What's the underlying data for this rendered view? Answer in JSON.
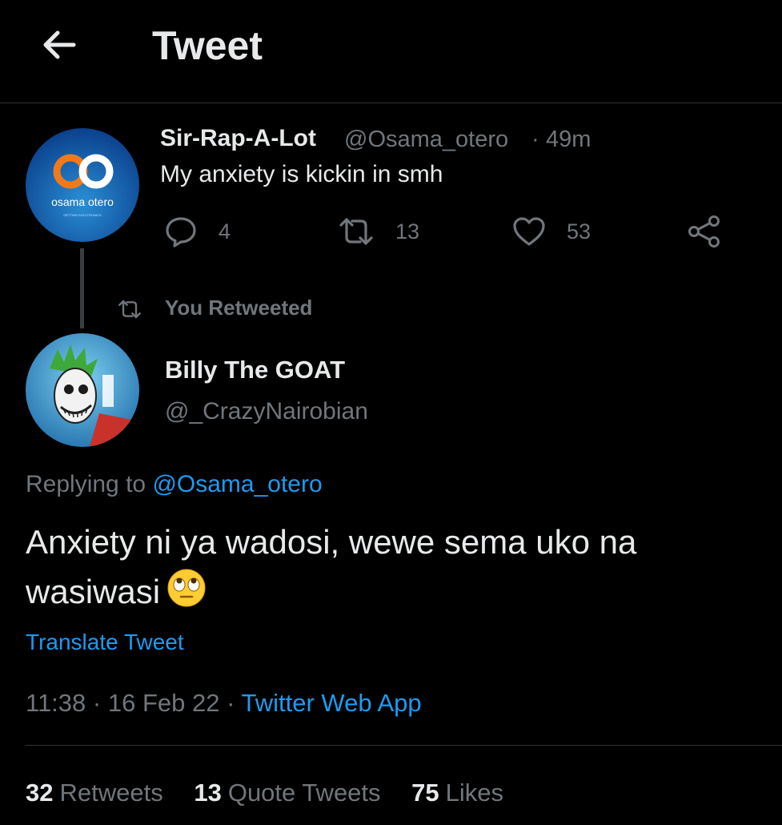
{
  "header": {
    "title": "Tweet",
    "back_icon": "arrow-left-icon"
  },
  "parent_tweet": {
    "display_name": "Sir-Rap-A-Lot",
    "handle": "@Osama_otero",
    "separator": "·",
    "time": "49m",
    "text": "My anxiety is kickin in smh",
    "avatar_text": "osama otero",
    "avatar_subtext": "GETTING ELECTRONICS",
    "actions": {
      "replies": "4",
      "retweets": "13",
      "likes": "53"
    }
  },
  "retweet_banner": {
    "label": "You Retweeted",
    "icon": "retweet-icon"
  },
  "main_tweet": {
    "display_name": "Billy The GOAT",
    "handle": "@_CrazyNairobian",
    "replying_prefix": "Replying to",
    "replying_handle": "@Osama_otero",
    "text": "Anxiety ni ya wadosi, wewe sema uko na wasiwasi",
    "translate_label": "Translate Tweet",
    "time": "11:38",
    "date": "16 Feb 22",
    "separator": "·",
    "source": "Twitter Web App",
    "stats": {
      "retweets_count": "32",
      "retweets_label": "Retweets",
      "quotes_count": "13",
      "quotes_label": "Quote Tweets",
      "likes_count": "75",
      "likes_label": "Likes"
    }
  },
  "colors": {
    "background": "#000000",
    "text": "#e7e9ea",
    "muted": "#71767b",
    "accent": "#1d9bf0",
    "divider": "#2f3336"
  }
}
